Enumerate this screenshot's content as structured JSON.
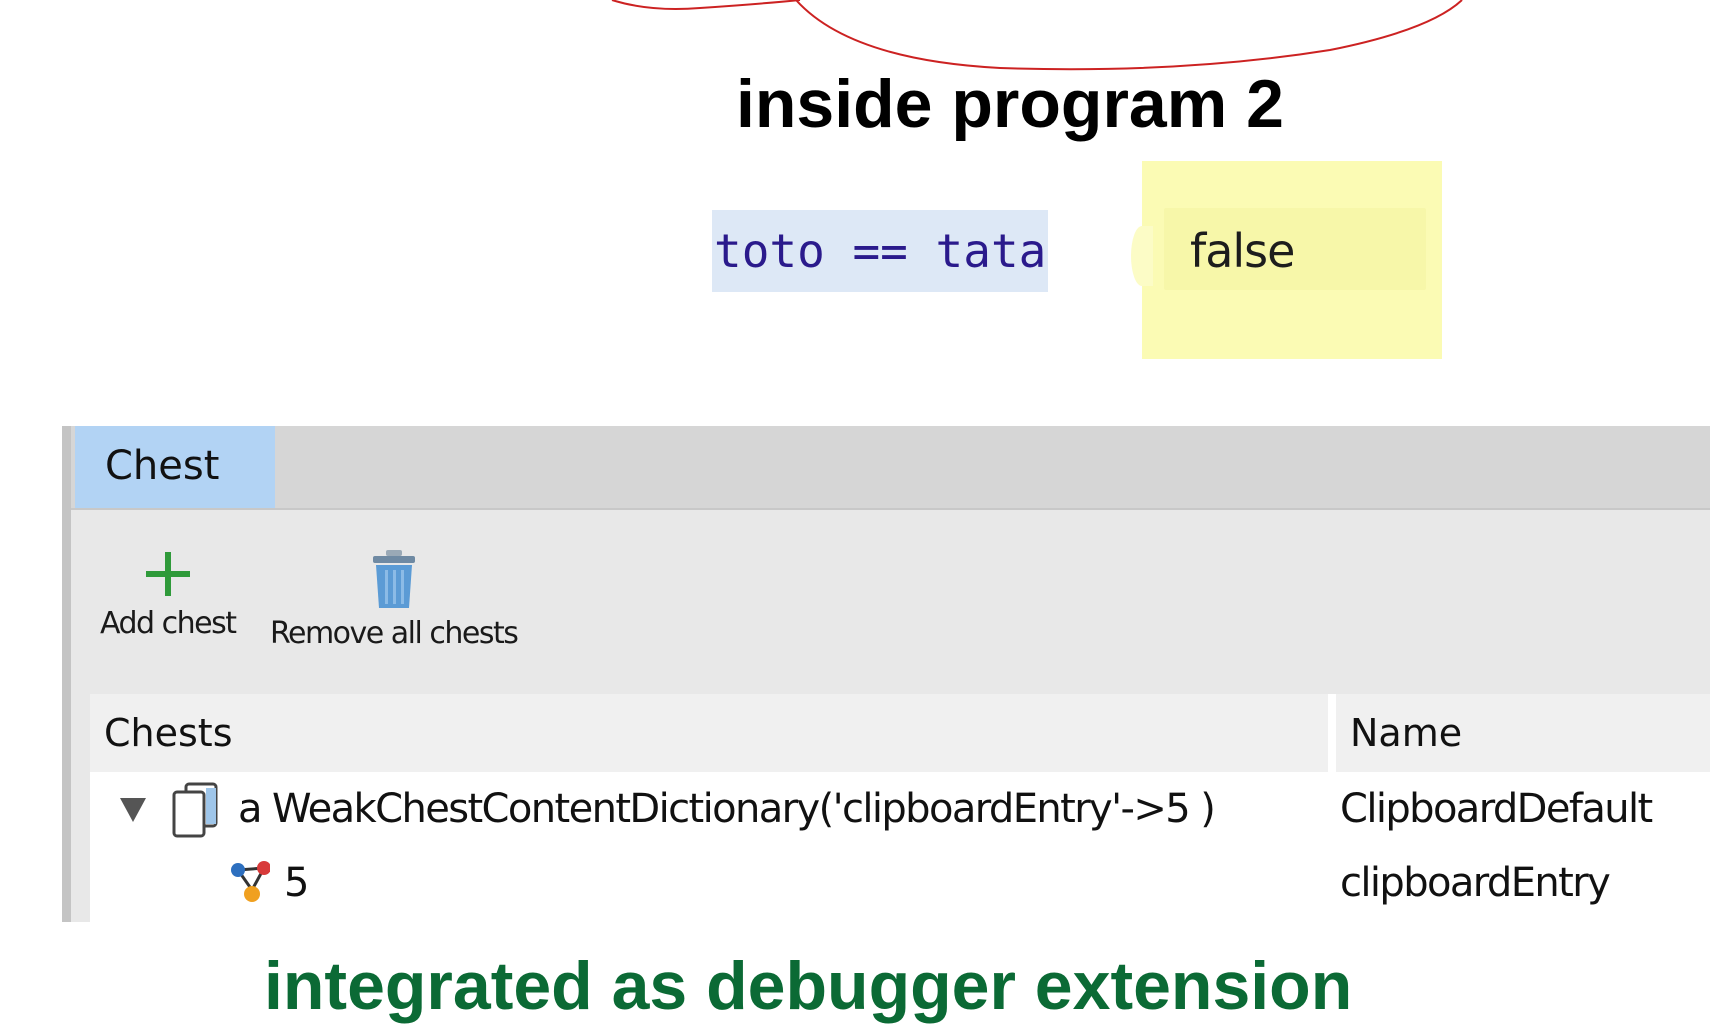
{
  "slide": {
    "top_heading": "inside program 2",
    "bottom_heading": "integrated as debugger extension",
    "bottom_heading_color": "#0b6a35",
    "callout_curve_color": "#cc2222"
  },
  "code": {
    "expression": "toto == tata",
    "result": "false"
  },
  "debugger": {
    "tab_label": "Chest",
    "tab_color": "#b2d3f4",
    "toolbar": {
      "add_label": "Add chest",
      "add_icon": "plus-icon",
      "remove_label": "Remove all chests",
      "remove_icon": "trash-icon"
    },
    "table": {
      "columns": [
        "Chests",
        "Name"
      ],
      "rows": [
        {
          "expand_icon": "triangle-down-icon",
          "icon": "dictionary-icon",
          "chests": "a WeakChestContentDictionary('clipboardEntry'->5 )",
          "name": "ClipboardDefault"
        },
        {
          "icon": "variable-icon",
          "chests": "5",
          "name": "clipboardEntry"
        }
      ]
    }
  }
}
